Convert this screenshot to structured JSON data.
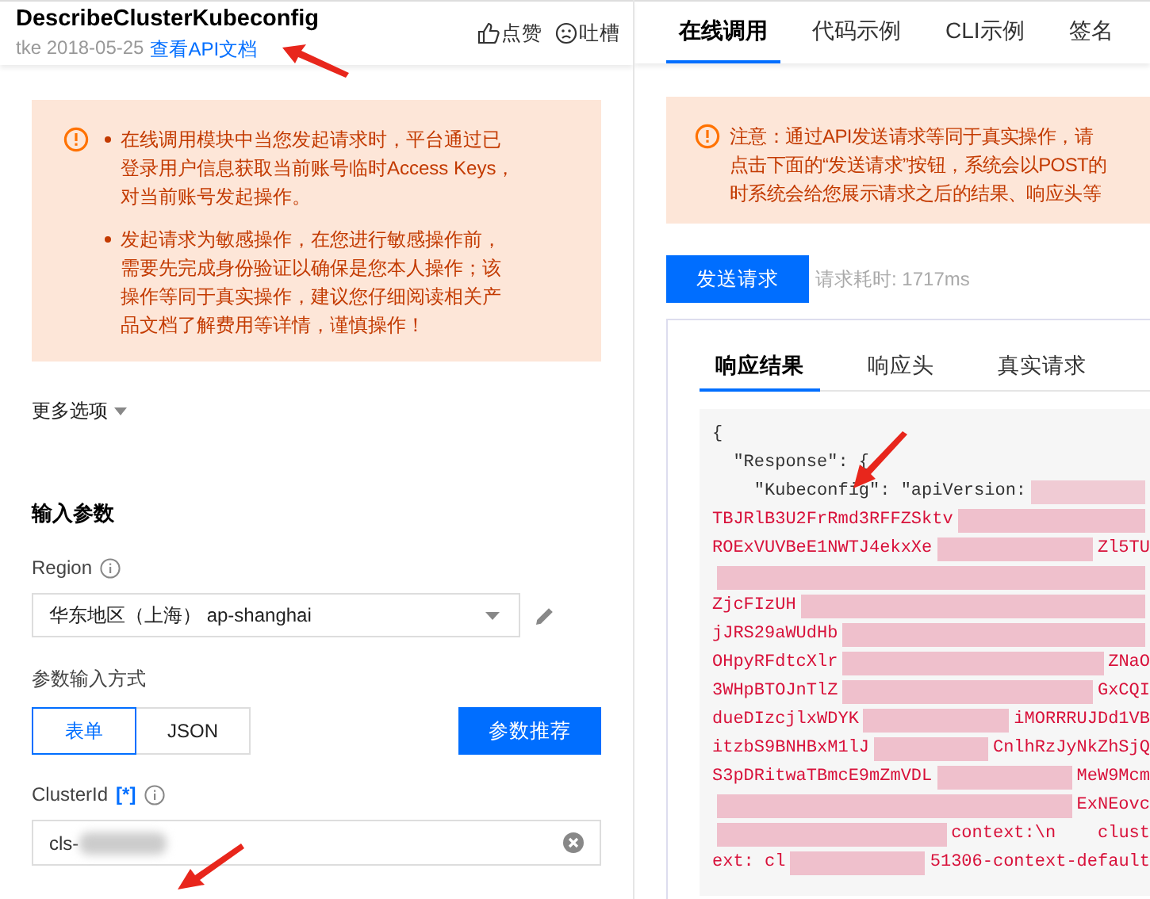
{
  "header": {
    "title": "DescribeClusterKubeconfig",
    "source": "tke",
    "date": "2018-05-25",
    "doc_link": "查看API文档",
    "actions": [
      {
        "kind": "like",
        "label": "点赞"
      },
      {
        "kind": "complain",
        "label": "吐槽"
      }
    ]
  },
  "left_notice": {
    "items": [
      "在线调用模块中当您发起请求时，平台通过已登录用户信息获取当前账号临时Access Keys，对当前账号发起操作。",
      "发起请求为敏感操作，在您进行敏感操作前，需要先完成身份验证以确保是您本人操作；该操作等同于真实操作，建议您仔细阅读相关产品文档了解费用等详情，谨慎操作！"
    ]
  },
  "more_options": "更多选项",
  "input_params": {
    "heading": "输入参数",
    "region": {
      "label": "Region",
      "value": "华东地区（上海） ap-shanghai"
    },
    "input_mode": {
      "label": "参数输入方式",
      "options": [
        {
          "label": "表单",
          "selected": true
        },
        {
          "label": "JSON",
          "selected": false
        }
      ],
      "recommend_button": "参数推荐"
    },
    "cluster_id": {
      "label": "ClusterId",
      "required_mark": "[*]",
      "value": "cls-"
    }
  },
  "tabs": [
    {
      "label": "在线调用",
      "selected": true
    },
    {
      "label": "代码示例",
      "selected": false
    },
    {
      "label": "CLI示例",
      "selected": false
    },
    {
      "label": "签名",
      "selected": false
    }
  ],
  "right_notice": {
    "lines": [
      "注意：通过API发送请求等同于真实操作，请",
      "点击下面的“发送请求”按钮，系统会以POST的",
      "时系统会给您展示请求之后的结果、响应头等"
    ]
  },
  "send_button": "发送请求",
  "elapsed": "请求耗时: 1717ms",
  "result_tabs": [
    {
      "label": "响应结果",
      "selected": true
    },
    {
      "label": "响应头",
      "selected": false
    },
    {
      "label": "真实请求",
      "selected": false
    }
  ],
  "response_lines": [
    {
      "kind": "plain",
      "left": "{"
    },
    {
      "kind": "plain",
      "left": "  \"Response\": {"
    },
    {
      "kind": "key",
      "left": "    \"Kubeconfig\": \"apiVersion:",
      "redacted": true
    },
    {
      "kind": "value",
      "left": "TBJRlB3U2FrRmd3RFFZSktv",
      "redacted": true
    },
    {
      "kind": "value",
      "left": "ROExVUVBeE1NWTJ4ekxXe",
      "redacted": true,
      "right": "Zl5TU"
    },
    {
      "kind": "value",
      "redacted": true
    },
    {
      "kind": "value",
      "left": "ZjcFIzUH",
      "redacted": true
    },
    {
      "kind": "value",
      "left": "jJRS29aWUdHb",
      "redacted": true
    },
    {
      "kind": "value",
      "left": "OHpyRFdtcXlr",
      "redacted": true,
      "right": "ZNaO"
    },
    {
      "kind": "value",
      "left": "3WHpBTOJnTlZ",
      "redacted": true,
      "right": "GxCQI"
    },
    {
      "kind": "value",
      "left": "dueDIzcjlxWDYK",
      "redacted": true,
      "right": "iMORRRUJDd1VB"
    },
    {
      "kind": "value",
      "left": "itzbS9BNHBxM1lJ",
      "redacted": true,
      "right": "CnlhRzJyNkZhSjQ"
    },
    {
      "kind": "value",
      "left": "S3pDRitwaTBmcE9mZmVDL",
      "redacted": true,
      "right": "MeW9Mcm"
    },
    {
      "kind": "value",
      "redacted": true,
      "right": "ExNEovc"
    },
    {
      "kind": "value",
      "redacted": true,
      "right": "context:\\n    clust"
    },
    {
      "kind": "value",
      "left": "ext: cl",
      "redacted": true,
      "right": "51306-context-default"
    }
  ]
}
